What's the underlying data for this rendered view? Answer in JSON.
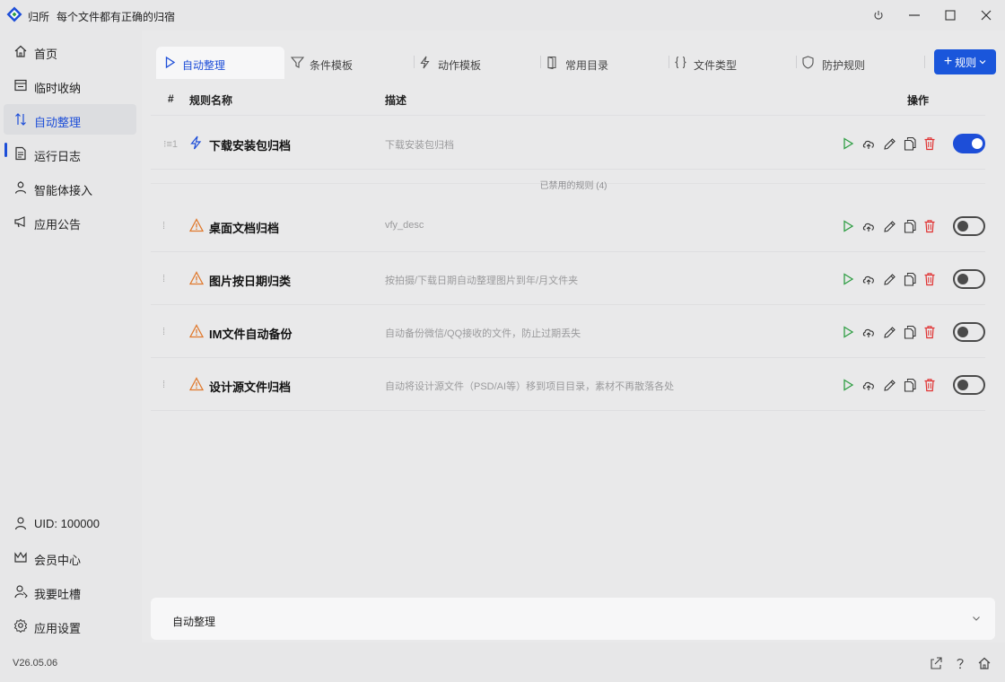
{
  "app": {
    "name": "归所",
    "slogan": "每个文件都有正确的归宿"
  },
  "window_controls": [
    "power-icon",
    "minimize-icon",
    "maximize-icon",
    "close-icon"
  ],
  "sidebar": {
    "items": [
      {
        "label": "首页",
        "icon": "home-icon"
      },
      {
        "label": "临时收纳",
        "icon": "inbox-icon"
      },
      {
        "label": "自动整理",
        "icon": "sort-icon",
        "active": true
      },
      {
        "label": "运行日志",
        "icon": "log-icon"
      },
      {
        "label": "智能体接入",
        "icon": "agent-icon"
      },
      {
        "label": "应用公告",
        "icon": "megaphone-icon"
      }
    ],
    "bottom": [
      {
        "label": "UID: 100000",
        "icon": "user-icon"
      },
      {
        "label": "会员中心",
        "icon": "crown-icon"
      },
      {
        "label": "我要吐槽",
        "icon": "feedback-icon"
      },
      {
        "label": "应用设置",
        "icon": "settings-icon"
      }
    ]
  },
  "tabs": [
    {
      "label": "自动整理",
      "icon": "play-icon",
      "active": true
    },
    {
      "label": "条件模板",
      "icon": "filter-icon"
    },
    {
      "label": "动作模板",
      "icon": "bolt-icon"
    },
    {
      "label": "常用目录",
      "icon": "door-icon"
    },
    {
      "label": "文件类型",
      "icon": "braces-icon"
    },
    {
      "label": "防护规则",
      "icon": "shield-icon"
    }
  ],
  "add_rule_button": {
    "label": "规则",
    "icon": "plus-icon"
  },
  "table": {
    "headers": {
      "index": "#",
      "name": "规则名称",
      "desc": "描述",
      "actions": "操作"
    },
    "enabled_rules": [
      {
        "handle": "⁝≡1",
        "name": "下载安装包归档",
        "desc": "下载安装包归档",
        "status_icon": "bolt-icon",
        "enabled": true
      }
    ],
    "disabled_label": "已禁用的规则 (4)",
    "disabled_rules": [
      {
        "handle": "⁞",
        "name": "桌面文档归档",
        "desc": "vfy_desc",
        "status_icon": "warning-icon",
        "enabled": false
      },
      {
        "handle": "⁞",
        "name": "图片按日期归类",
        "desc": "按拍摄/下载日期自动整理图片到年/月文件夹",
        "status_icon": "warning-icon",
        "enabled": false
      },
      {
        "handle": "⁞",
        "name": "IM文件自动备份",
        "desc": "自动备份微信/QQ接收的文件，防止过期丢失",
        "status_icon": "warning-icon",
        "enabled": false
      },
      {
        "handle": "⁞",
        "name": "设计源文件归档",
        "desc": "自动将设计源文件（PSD/AI等）移到项目目录，素材不再散落各处",
        "status_icon": "warning-icon",
        "enabled": false
      }
    ],
    "row_actions": [
      "run-icon",
      "upload-icon",
      "edit-icon",
      "copy-icon",
      "delete-icon"
    ]
  },
  "bottom_panel": {
    "label": "自动整理",
    "icon": "chevron-down-icon"
  },
  "statusbar": {
    "version": "V26.05.06",
    "icons": [
      "share-icon",
      "help-icon",
      "home-icon"
    ]
  },
  "colors": {
    "accent": "#1d4ed8",
    "warning": "#e07a2e",
    "run": "#2f9e44",
    "delete": "#e03131"
  }
}
